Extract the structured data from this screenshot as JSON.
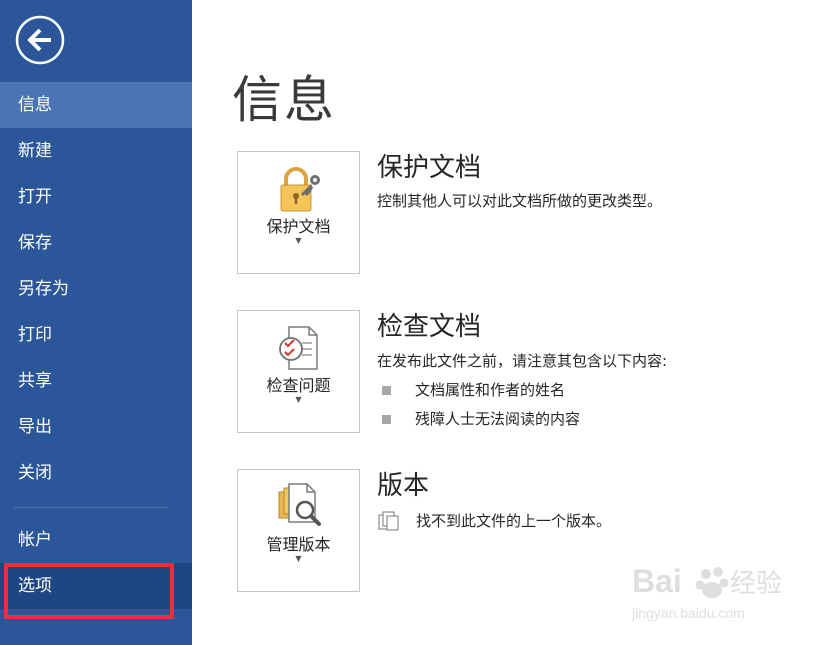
{
  "sidebar": {
    "items": [
      {
        "label": "信息",
        "state": "active"
      },
      {
        "label": "新建"
      },
      {
        "label": "打开"
      },
      {
        "label": "保存"
      },
      {
        "label": "另存为"
      },
      {
        "label": "打印"
      },
      {
        "label": "共享"
      },
      {
        "label": "导出"
      },
      {
        "label": "关闭"
      },
      {
        "label": "帐户"
      },
      {
        "label": "选项",
        "state": "hover"
      }
    ],
    "back_icon": "back-arrow-circle-icon"
  },
  "main": {
    "title": "信息",
    "sections": [
      {
        "tile_label": "保护文档",
        "tile_icon": "lock-key-icon",
        "heading": "保护文档",
        "description": "控制其他人可以对此文档所做的更改类型。"
      },
      {
        "tile_label": "检查问题",
        "tile_icon": "checklist-icon",
        "heading": "检查文档",
        "description": "在发布此文件之前，请注意其包含以下内容:",
        "bullets": [
          "文档属性和作者的姓名",
          "残障人士无法阅读的内容"
        ]
      },
      {
        "tile_label": "管理版本",
        "tile_icon": "document-versions-magnifier-icon",
        "heading": "版本",
        "description": "找不到此文件的上一个版本。"
      }
    ]
  },
  "watermark": {
    "brand": "Baidu",
    "brand_cn": "经验",
    "url": "jingyan.baidu.com"
  },
  "colors": {
    "sidebar_bg": "#2b579a",
    "sidebar_active": "#4a75b5",
    "sidebar_hover": "#1e4684",
    "highlight": "#e8313d"
  }
}
